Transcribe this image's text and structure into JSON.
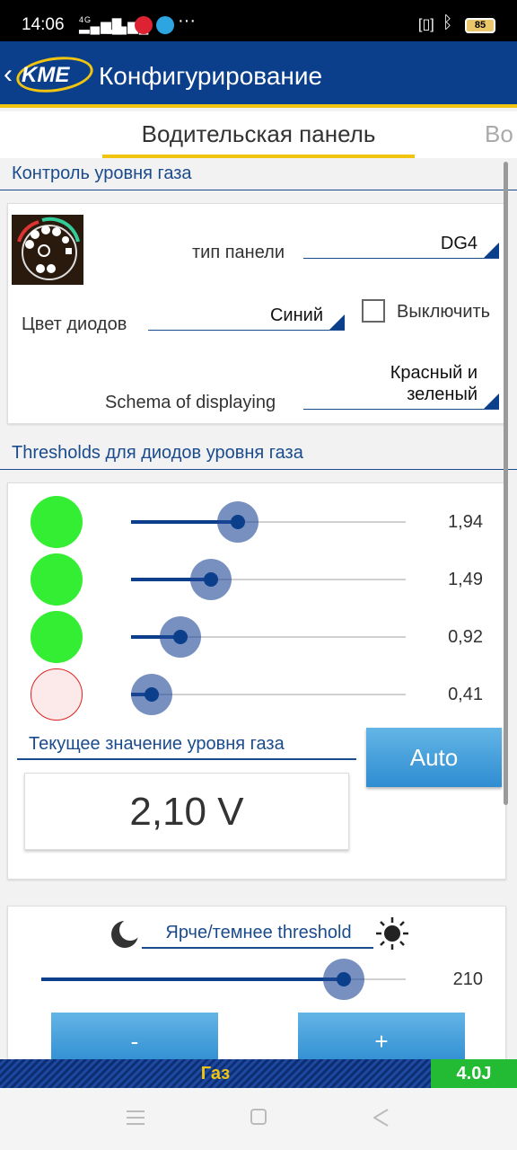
{
  "status_bar": {
    "time": "14:06",
    "network": "4G",
    "battery": "85"
  },
  "app_bar": {
    "logo_text": "KME",
    "title": "Конфигурирование"
  },
  "tabs": {
    "active": "Водительская панель",
    "next_partial": "Во"
  },
  "gas_level_control": {
    "header": "Контроль уровня газа",
    "panel_type_label": "тип панели",
    "panel_type_value": "DG4",
    "diode_color_label": "Цвет диодов",
    "diode_color_value": "Синий",
    "disable_label": "Выключить",
    "disable_checked": false,
    "schema_label": "Schema of displaying",
    "schema_value": "Красный и зеленый"
  },
  "thresholds": {
    "header": "Thresholds для диодов уровня газа",
    "rows": [
      {
        "value": "1,94",
        "led": "on",
        "slider_fraction": 0.39
      },
      {
        "value": "1,49",
        "led": "on",
        "slider_fraction": 0.29
      },
      {
        "value": "0,92",
        "led": "on",
        "slider_fraction": 0.18
      },
      {
        "value": "0,41",
        "led": "off",
        "slider_fraction": 0.075
      }
    ],
    "current_label": "Текущее значение уровня газа",
    "current_value": "2,10 V",
    "auto_label": "Auto"
  },
  "brightness": {
    "label": "Ярче/темнее threshold",
    "value": "210",
    "slider_fraction": 0.83,
    "minus_label": "-",
    "plus_label": "+"
  },
  "footer": {
    "fuel": "Газ",
    "version": "4.0J"
  },
  "colors": {
    "primary": "#0b3f8c",
    "accent": "#f1c40f",
    "led_on": "#33ee33",
    "version_bg": "#22bb33"
  },
  "icons": {
    "back": "chevron-left-icon",
    "moon": "moon-icon",
    "sun": "sun-icon"
  }
}
